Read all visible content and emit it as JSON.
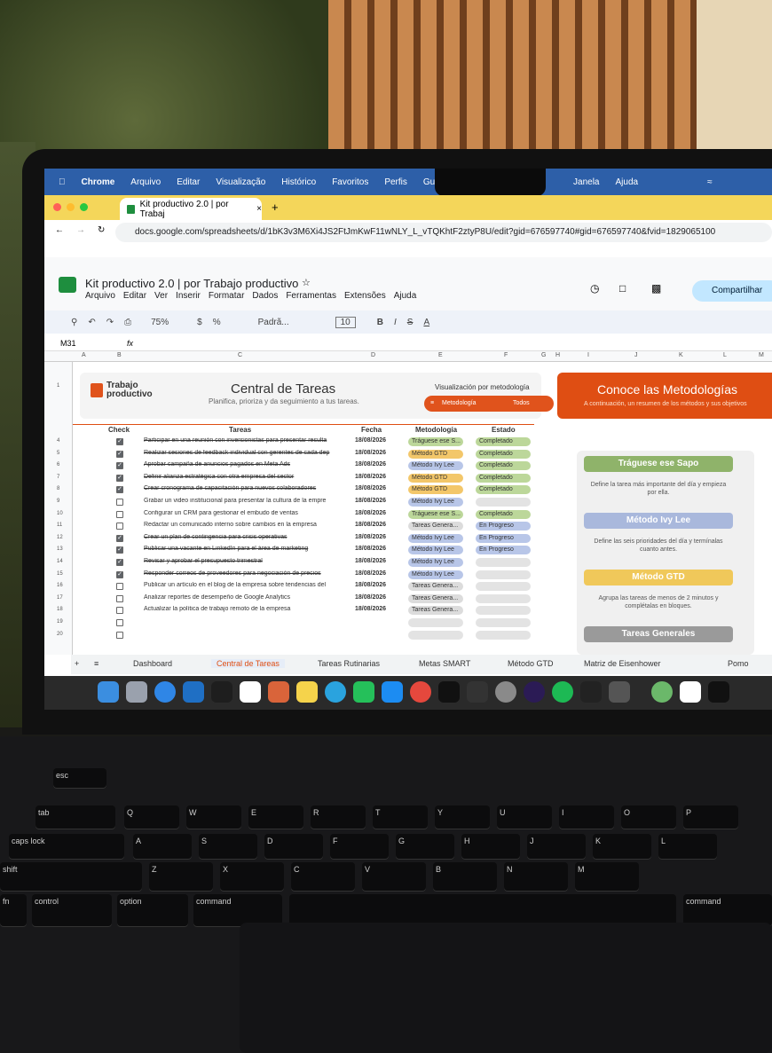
{
  "mac_menu": {
    "app": "Chrome",
    "items": [
      "Arquivo",
      "Editar",
      "Visualização",
      "Histórico",
      "Favoritos",
      "Perfis",
      "Guia"
    ],
    "right_items": [
      "Janela",
      "Ajuda"
    ]
  },
  "browser": {
    "tab_title": "Kit productivo 2.0 | por Trabaj",
    "url": "docs.google.com/spreadsheets/d/1bK3v3M6Xi4JS2FtJmKwF11wNLY_L_vTQKhtF2ztyP8U/edit?gid=676597740#gid=676597740&fvid=1829065100"
  },
  "sheets": {
    "doc_title": "Kit productivo 2.0 | por Trabajo productivo",
    "menu": [
      "Arquivo",
      "Editar",
      "Ver",
      "Inserir",
      "Formatar",
      "Dados",
      "Ferramentas",
      "Extensões",
      "Ajuda"
    ],
    "share_label": "Compartilhar",
    "zoom": "75%",
    "font": "Padrã...",
    "font_size": "10",
    "cell_ref": "M31",
    "fx": "fx",
    "columns": [
      "A",
      "B",
      "C",
      "D",
      "E",
      "F",
      "G",
      "H",
      "I",
      "J",
      "K",
      "L",
      "M"
    ]
  },
  "header": {
    "logo_text": "Trabajo productivo",
    "title": "Central de Tareas",
    "subtitle": "Planifica, prioriza y da seguimiento a tus tareas.",
    "viz_label": "Visualización por metodología",
    "viz_filter": "Metodología",
    "viz_value": "Todos",
    "conoce_title": "Conoce las Metodologías",
    "conoce_sub": "A continuación, un resumen de los métodos y sus objetivos"
  },
  "table": {
    "headers": [
      "Check",
      "Tareas",
      "Fecha",
      "Metodología",
      "Estado"
    ],
    "rows": [
      {
        "n": "4",
        "checked": true,
        "task": "Participar en una reunión con inversionistas para presentar resulta",
        "fecha": "18/08/2026",
        "met": "Tráguese ese S...",
        "est": "Completado",
        "done": true
      },
      {
        "n": "5",
        "checked": true,
        "task": "Realizar sesiones de feedback individual con gerentes de cada dep",
        "fecha": "18/08/2026",
        "met": "Método GTD",
        "est": "Completado",
        "done": true
      },
      {
        "n": "6",
        "checked": true,
        "task": "Aprobar campaña de anuncios pagados en Meta Ads",
        "fecha": "18/08/2026",
        "met": "Método Ivy Lee",
        "est": "Completado",
        "done": true
      },
      {
        "n": "7",
        "checked": true,
        "task": "Definir alianza estratégica con otra empresa del sector",
        "fecha": "18/08/2026",
        "met": "Método GTD",
        "est": "Completado",
        "done": true
      },
      {
        "n": "8",
        "checked": true,
        "task": "Crear cronograma de capacitación para nuevos colaboradores",
        "fecha": "18/08/2026",
        "met": "Método GTD",
        "est": "Completado",
        "done": true
      },
      {
        "n": "9",
        "checked": false,
        "task": "Grabar un video institucional para presentar la cultura de la empre",
        "fecha": "18/08/2026",
        "met": "Método Ivy Lee",
        "est": "",
        "done": false
      },
      {
        "n": "10",
        "checked": false,
        "task": "Configurar un CRM para gestionar el embudo de ventas",
        "fecha": "18/08/2026",
        "met": "Tráguese ese S...",
        "est": "Completado",
        "done": false
      },
      {
        "n": "11",
        "checked": false,
        "task": "Redactar un comunicado interno sobre cambios en la empresa",
        "fecha": "18/08/2026",
        "met": "Tareas Genera...",
        "est": "En Progreso",
        "done": false
      },
      {
        "n": "12",
        "checked": true,
        "task": "Crear un plan de contingencia para crisis operativas",
        "fecha": "18/08/2026",
        "met": "Método Ivy Lee",
        "est": "En Progreso",
        "done": true
      },
      {
        "n": "13",
        "checked": true,
        "task": "Publicar una vacante en LinkedIn para el área de marketing",
        "fecha": "18/08/2026",
        "met": "Método Ivy Lee",
        "est": "En Progreso",
        "done": true
      },
      {
        "n": "14",
        "checked": true,
        "task": "Revisar y aprobar el presupuesto trimestral",
        "fecha": "18/08/2026",
        "met": "Método Ivy Lee",
        "est": "",
        "done": true
      },
      {
        "n": "15",
        "checked": true,
        "task": "Responder correos de proveedores para negociación de precios",
        "fecha": "18/08/2026",
        "met": "Método Ivy Lee",
        "est": "",
        "done": true
      },
      {
        "n": "16",
        "checked": false,
        "task": "Publicar un artículo en el blog de la empresa sobre tendencias del",
        "fecha": "18/08/2026",
        "met": "Tareas Genera...",
        "est": "",
        "done": false
      },
      {
        "n": "17",
        "checked": false,
        "task": "Analizar reportes de desempeño de Google Analytics",
        "fecha": "18/08/2026",
        "met": "Tareas Genera...",
        "est": "",
        "done": false
      },
      {
        "n": "18",
        "checked": false,
        "task": "Actualizar la política de trabajo remoto de la empresa",
        "fecha": "18/08/2026",
        "met": "Tareas Genera...",
        "est": "",
        "done": false
      },
      {
        "n": "19",
        "checked": false,
        "task": "",
        "fecha": "",
        "met": "",
        "est": "",
        "done": false
      },
      {
        "n": "20",
        "checked": false,
        "task": "",
        "fecha": "",
        "met": "",
        "est": "",
        "done": false
      }
    ]
  },
  "methods": [
    {
      "title": "Tráguese ese Sapo",
      "desc": "Define la tarea más importante del día y empieza por ella.",
      "color": "#8fb36a"
    },
    {
      "title": "Método Ivy Lee",
      "desc": "Define las seis prioridades del día y termínalas cuanto antes.",
      "color": "#a9b8dc"
    },
    {
      "title": "Método GTD",
      "desc": "Agrupa las tareas de menos de 2 minutos y complétalas en bloques.",
      "color": "#f0c85a"
    },
    {
      "title": "Tareas Generales",
      "desc": "",
      "color": "#9a9a9a"
    }
  ],
  "sheet_tabs": [
    "Dashboard",
    "Central de Tareas",
    "Tareas Rutinarias",
    "Metas SMART",
    "Método GTD",
    "Matriz de Eisenhower",
    "Pomo"
  ],
  "colors": {
    "accent": "#df4e13",
    "sheets_green": "#1e8e3e",
    "menubar": "#2d5fa8",
    "chrome_tab": "#f4d65a"
  },
  "keyboard": {
    "keys": [
      "esc",
      "tab",
      "caps lock",
      "shift",
      "fn",
      "control",
      "option",
      "command",
      "command",
      "Q",
      "W",
      "E",
      "R",
      "T",
      "Y",
      "U",
      "I",
      "O",
      "P",
      "A",
      "S",
      "D",
      "F",
      "G",
      "H",
      "J",
      "K",
      "L",
      "Z",
      "X",
      "C",
      "V",
      "B",
      "N",
      "M"
    ]
  }
}
